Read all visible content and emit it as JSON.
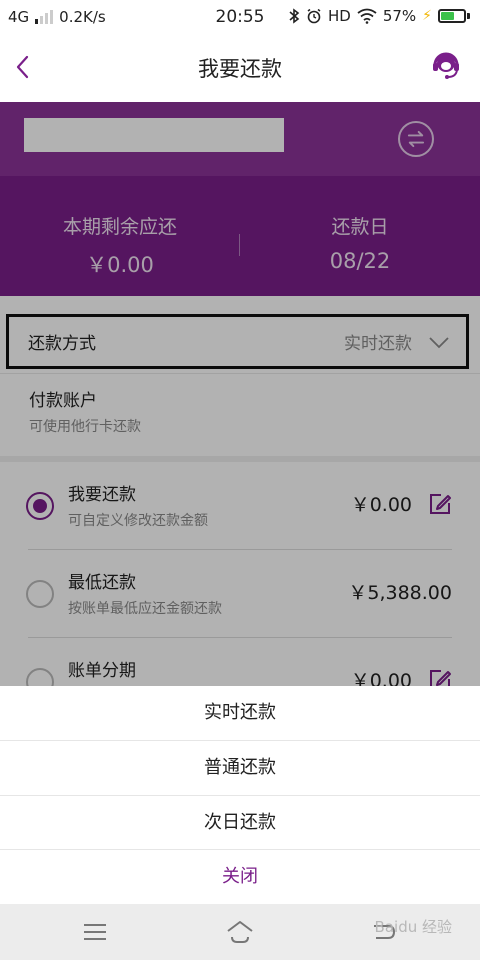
{
  "status_bar": {
    "network": "4G",
    "speed": "0.2K/s",
    "time": "20:55",
    "hd": "HD",
    "battery": "57%",
    "battery_level": 0.57
  },
  "header": {
    "title": "我要还款"
  },
  "summary": {
    "remaining_label": "本期剩余应还",
    "remaining_value": "￥0.00",
    "due_label": "还款日",
    "due_value": "08/22"
  },
  "method": {
    "label": "还款方式",
    "value": "实时还款"
  },
  "account": {
    "label": "付款账户",
    "sub": "可使用他行卡还款"
  },
  "options": [
    {
      "name": "我要还款",
      "desc": "可自定义修改还款金额",
      "amount": "￥0.00"
    },
    {
      "name": "最低还款",
      "desc": "按账单最低应还金额还款",
      "amount": "￥5,388.00"
    },
    {
      "name": "账单分期",
      "amount": "￥0.00"
    }
  ],
  "sheet": {
    "items": [
      "实时还款",
      "普通还款",
      "次日还款"
    ],
    "close": "关闭"
  },
  "watermark": "Baidu 经验",
  "colors": {
    "brand_purple": "#7a1f8a",
    "battery_green": "#3bc14a"
  }
}
